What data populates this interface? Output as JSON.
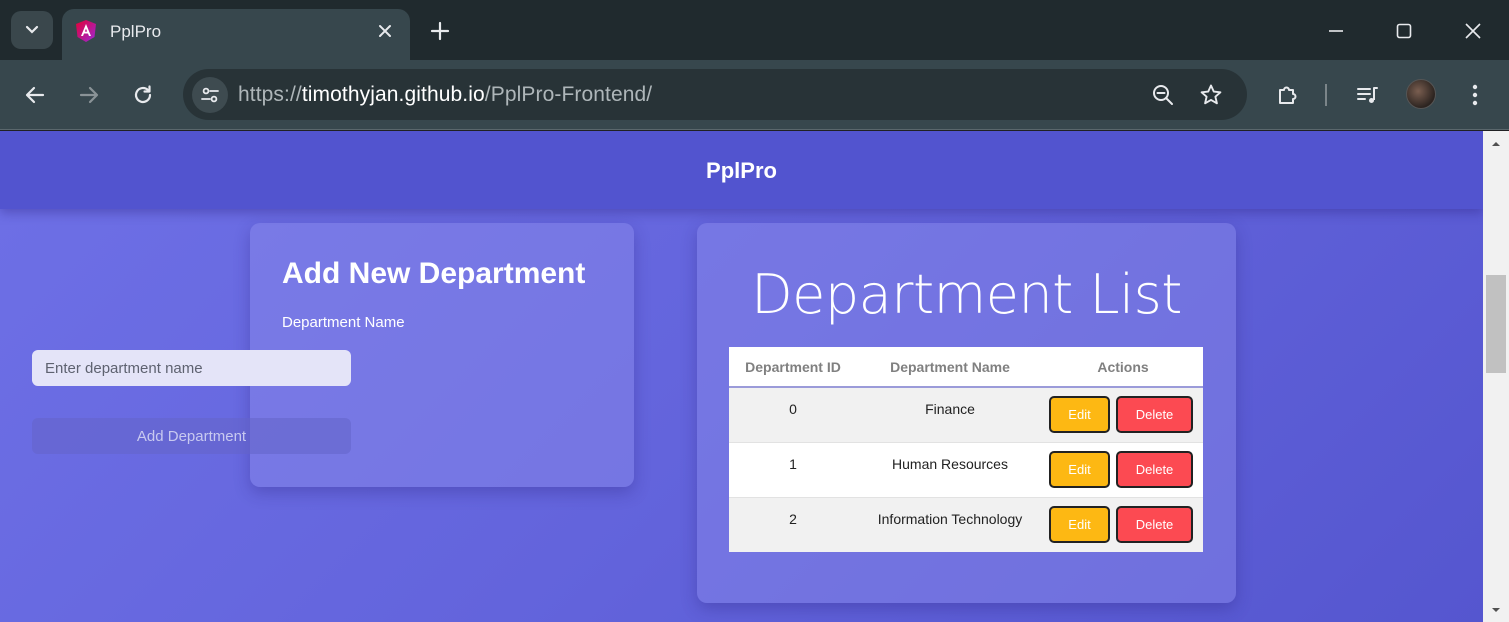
{
  "browser": {
    "tab_title": "PplPro",
    "url": {
      "scheme": "https://",
      "host": "timothyjan.github.io",
      "path": "/PplPro-Frontend/"
    }
  },
  "app": {
    "title": "PplPro"
  },
  "add_form": {
    "heading": "Add New Department",
    "name_label": "Department Name",
    "name_placeholder": "Enter department name",
    "name_value": "",
    "submit_label": "Add Department"
  },
  "department_list": {
    "heading": "Department List",
    "columns": [
      "Department ID",
      "Department Name",
      "Actions"
    ],
    "rows": [
      {
        "id": "0",
        "name": "Finance"
      },
      {
        "id": "1",
        "name": "Human Resources"
      },
      {
        "id": "2",
        "name": "Information Technology"
      }
    ],
    "edit_label": "Edit",
    "delete_label": "Delete"
  },
  "colors": {
    "header": "#5254cf",
    "edit_button": "#fdb813",
    "delete_button": "#fc4a52"
  }
}
